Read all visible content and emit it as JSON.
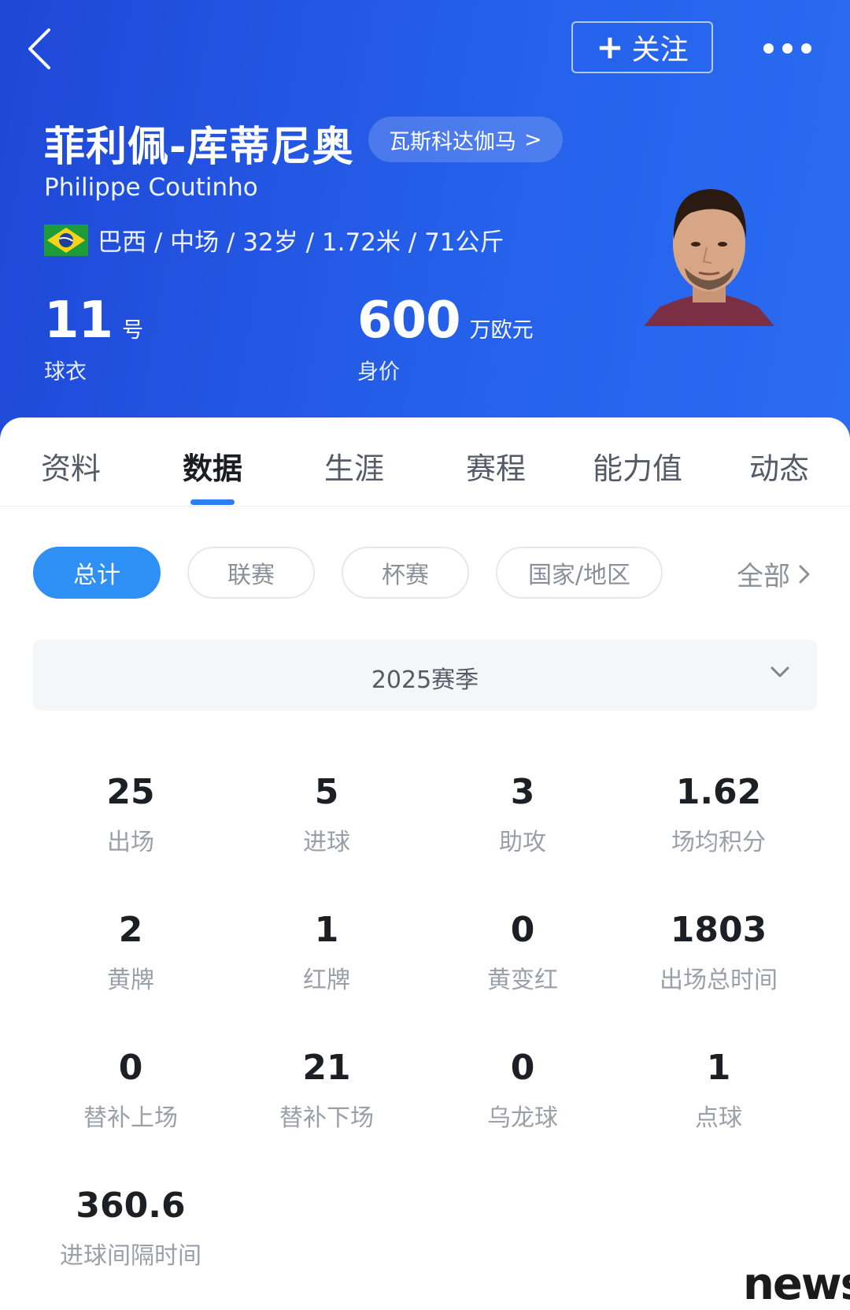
{
  "header": {
    "follow_label": "关注",
    "player_name": "菲利佩-库蒂尼奥",
    "team": "瓦斯科达伽马",
    "team_chevron": ">",
    "name_en": "Philippe Coutinho",
    "info": "巴西 / 中场 / 32岁 / 1.72米 / 71公斤",
    "jersey_number": "11",
    "jersey_unit": "号",
    "jersey_label": "球衣",
    "market_value": "600",
    "market_value_unit": "万欧元",
    "market_value_label": "身价"
  },
  "tabs": [
    "资料",
    "数据",
    "生涯",
    "赛程",
    "能力值",
    "动态"
  ],
  "active_tab": "数据",
  "filters": {
    "chips": [
      "总计",
      "联赛",
      "杯赛",
      "国家/地区"
    ],
    "active": "总计",
    "all_label": "全部"
  },
  "season": {
    "selected": "2025赛季"
  },
  "stats": [
    {
      "value": "25",
      "label": "出场"
    },
    {
      "value": "5",
      "label": "进球"
    },
    {
      "value": "3",
      "label": "助攻"
    },
    {
      "value": "1.62",
      "label": "场均积分"
    },
    {
      "value": "2",
      "label": "黄牌"
    },
    {
      "value": "1",
      "label": "红牌"
    },
    {
      "value": "0",
      "label": "黄变红"
    },
    {
      "value": "1803",
      "label": "出场总时间"
    },
    {
      "value": "0",
      "label": "替补上场"
    },
    {
      "value": "21",
      "label": "替补下场"
    },
    {
      "value": "0",
      "label": "乌龙球"
    },
    {
      "value": "1",
      "label": "点球"
    },
    {
      "value": "360.6",
      "label": "进球间隔时间"
    }
  ],
  "watermark": "news",
  "colors": {
    "header_bg": "#2560ea",
    "accent": "#2e8ff4",
    "tab_underline": "#2e7cf6"
  }
}
